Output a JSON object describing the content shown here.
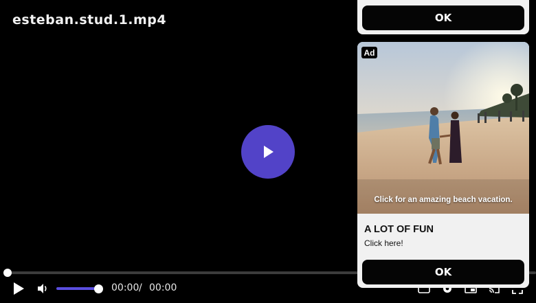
{
  "player": {
    "title": "esteban.stud.1.mp4",
    "current_time": "00:00",
    "time_separator": "/",
    "duration": "00:00",
    "progress_fraction": 0,
    "volume_fraction": 1,
    "accent_color": "#5243c8"
  },
  "ad": {
    "top_ok_label": "OK",
    "badge": "Ad",
    "image_caption": "Click for an amazing beach vacation.",
    "headline": "A LOT OF FUN",
    "subtext": "Click here!",
    "ok_label": "OK"
  },
  "icons": {
    "big_play": "play-icon",
    "play": "play-icon",
    "volume": "volume-icon",
    "subtitles": "subtitles-icon",
    "settings": "gear-icon",
    "pip": "picture-in-picture-icon",
    "cast": "cast-icon",
    "fullscreen": "fullscreen-icon"
  }
}
